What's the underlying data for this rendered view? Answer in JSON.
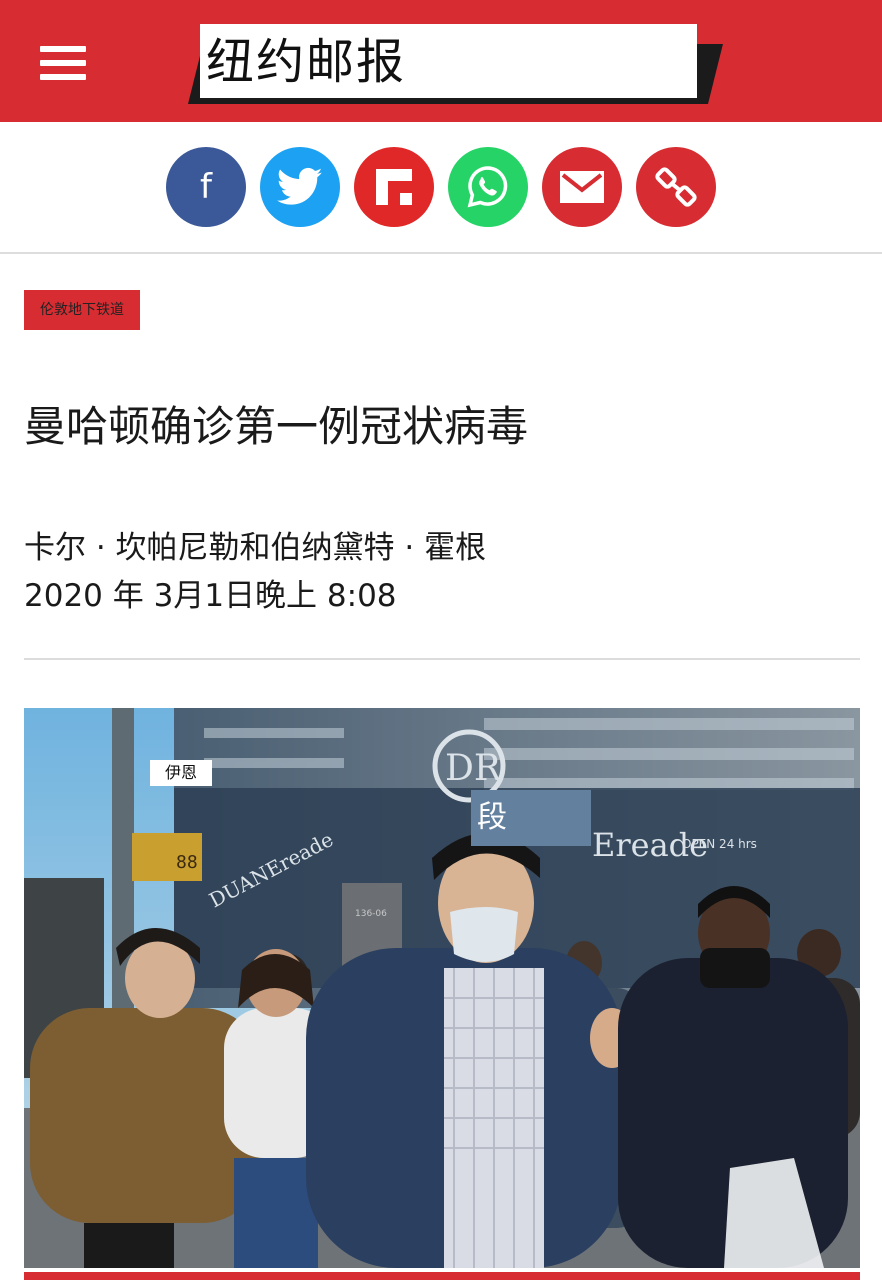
{
  "header": {
    "logo_text": "纽约邮报",
    "menu_icon": "hamburger-menu-icon",
    "background_color": "#d62c32"
  },
  "share_buttons": [
    {
      "name": "facebook",
      "icon": "facebook-icon",
      "color": "#3b5998"
    },
    {
      "name": "twitter",
      "icon": "twitter-icon",
      "color": "#1da1f2"
    },
    {
      "name": "flipboard",
      "icon": "flipboard-icon",
      "color": "#e12828"
    },
    {
      "name": "whatsapp",
      "icon": "whatsapp-icon",
      "color": "#25d366"
    },
    {
      "name": "email",
      "icon": "email-icon",
      "color": "#d62c32"
    },
    {
      "name": "copy-link",
      "icon": "link-icon",
      "color": "#d62c32"
    }
  ],
  "facebook_letter": "f",
  "article": {
    "category": "伦敦地下铁道",
    "headline": "曼哈顿确诊第一例冠状病毒",
    "byline": "卡尔 · 坎帕尼勒和伯纳黛特 · 霍根",
    "date": "2020 年 3月1日晚上 8:08"
  },
  "photo": {
    "credit_label_1": "伊恩",
    "credit_label_2": "段",
    "sign_text_dr": "DR",
    "sign_text_store": "Ereade",
    "sign_text_open": "OPEN 24 hrs",
    "sign_text_side": "DUANEreade",
    "address_text": "136-06",
    "traffic_signal_text": "88"
  }
}
